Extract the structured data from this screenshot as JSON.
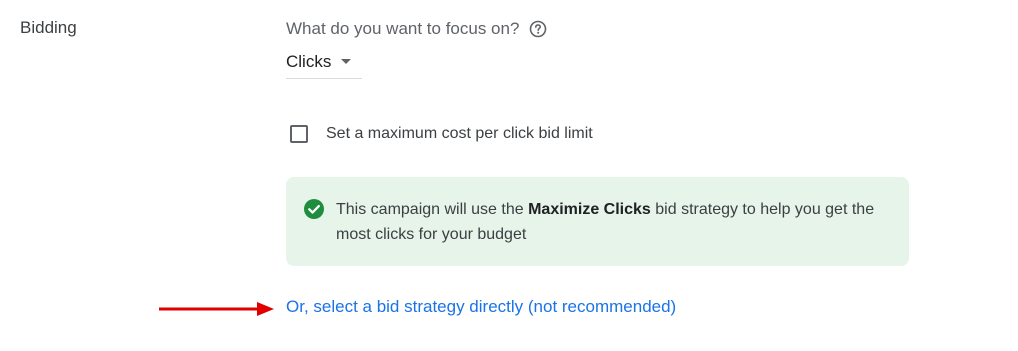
{
  "section": {
    "label": "Bidding"
  },
  "focus": {
    "question": "What do you want to focus on?",
    "help_icon": "help-circle-icon",
    "selected": "Clicks"
  },
  "max_cpc": {
    "label": "Set a maximum cost per click bid limit",
    "checked": false
  },
  "info": {
    "icon": "check-circle-icon",
    "text_before": "This campaign will use the ",
    "strategy_name": "Maximize Clicks",
    "text_after": " bid strategy to help you get the most clicks for your budget"
  },
  "link": {
    "label": "Or, select a bid strategy directly (not recommended)"
  },
  "colors": {
    "info_background": "#e6f4ea",
    "success_green": "#1e8e3e",
    "link_blue": "#1a73e8",
    "annotation_arrow": "#e00000"
  }
}
